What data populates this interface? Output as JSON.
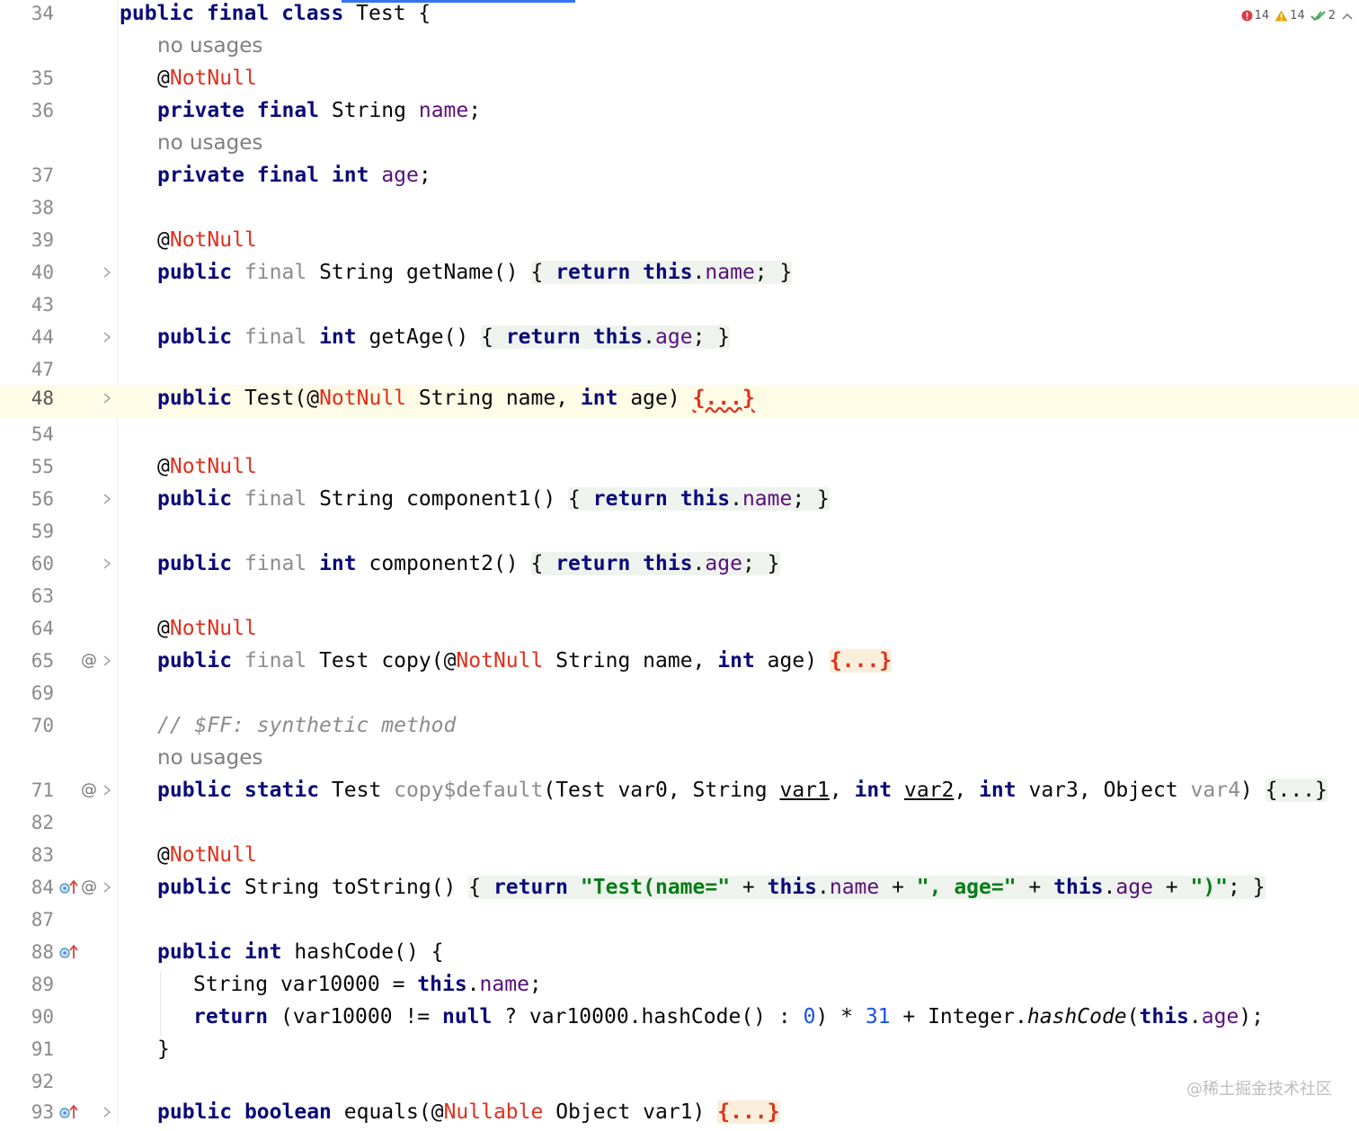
{
  "status": {
    "errors": "14",
    "warnings": "14",
    "weak_warnings": "2"
  },
  "watermark": "@稀土掘金技术社区",
  "hints": {
    "no_usages": "no usages"
  },
  "lines": [
    {
      "num": "34"
    },
    {
      "num": "35"
    },
    {
      "num": "36"
    },
    {
      "num": "37"
    },
    {
      "num": "38"
    },
    {
      "num": "39"
    },
    {
      "num": "40"
    },
    {
      "num": "43"
    },
    {
      "num": "44"
    },
    {
      "num": "47"
    },
    {
      "num": "48"
    },
    {
      "num": "54"
    },
    {
      "num": "55"
    },
    {
      "num": "56"
    },
    {
      "num": "59"
    },
    {
      "num": "60"
    },
    {
      "num": "63"
    },
    {
      "num": "64"
    },
    {
      "num": "65"
    },
    {
      "num": "69"
    },
    {
      "num": "70"
    },
    {
      "num": "71"
    },
    {
      "num": "82"
    },
    {
      "num": "83"
    },
    {
      "num": "84"
    },
    {
      "num": "87"
    },
    {
      "num": "88"
    },
    {
      "num": "89"
    },
    {
      "num": "90"
    },
    {
      "num": "91"
    },
    {
      "num": "92"
    },
    {
      "num": "93"
    }
  ],
  "tokens": {
    "public": "public",
    "final": "final",
    "class": "class",
    "private": "private",
    "static": "static",
    "int": "int",
    "boolean": "boolean",
    "return": "return",
    "this": "this",
    "null": "null",
    "NotNull": "NotNull",
    "Nullable": "Nullable",
    "at": "@",
    "String": "String",
    "Test": "Test",
    "Object": "Object",
    "Integer": "Integer",
    "name": "name",
    "age": "age",
    "getName": "getName",
    "getAge": "getAge",
    "component1": "component1",
    "component2": "component2",
    "copy": "copy",
    "copy_default": "copy$default",
    "toString": "toString",
    "hashCode": "hashCode",
    "equals": "equals",
    "var0": "var0",
    "var1": "var1",
    "var2": "var2",
    "var3": "var3",
    "var4": "var4",
    "var10000": "var10000",
    "fold": "{...}",
    "comment_70": "// $FF: synthetic method",
    "str_test_name": "\"Test(name=\"",
    "str_age": "\", age=\"",
    "str_close": "\")\"",
    "zero": "0",
    "thirty_one": "31"
  }
}
